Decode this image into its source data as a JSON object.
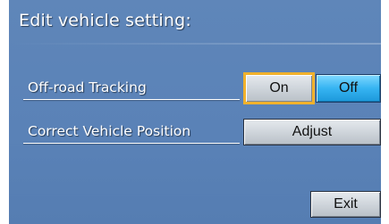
{
  "header": {
    "title": "Edit vehicle setting:"
  },
  "settings": {
    "offroad": {
      "label": "Off-road Tracking",
      "options": [
        "On",
        "Off"
      ],
      "selected": "Off",
      "focused": "On"
    },
    "position": {
      "label": "Correct Vehicle Position",
      "action_label": "Adjust"
    }
  },
  "footer": {
    "exit_label": "Exit"
  },
  "colors": {
    "background": "#5a82b7",
    "focus_border": "#f0b12c",
    "selected_fill": "#36b4f2",
    "button_fill": "#cfd5db",
    "text_light": "#ffffff"
  }
}
